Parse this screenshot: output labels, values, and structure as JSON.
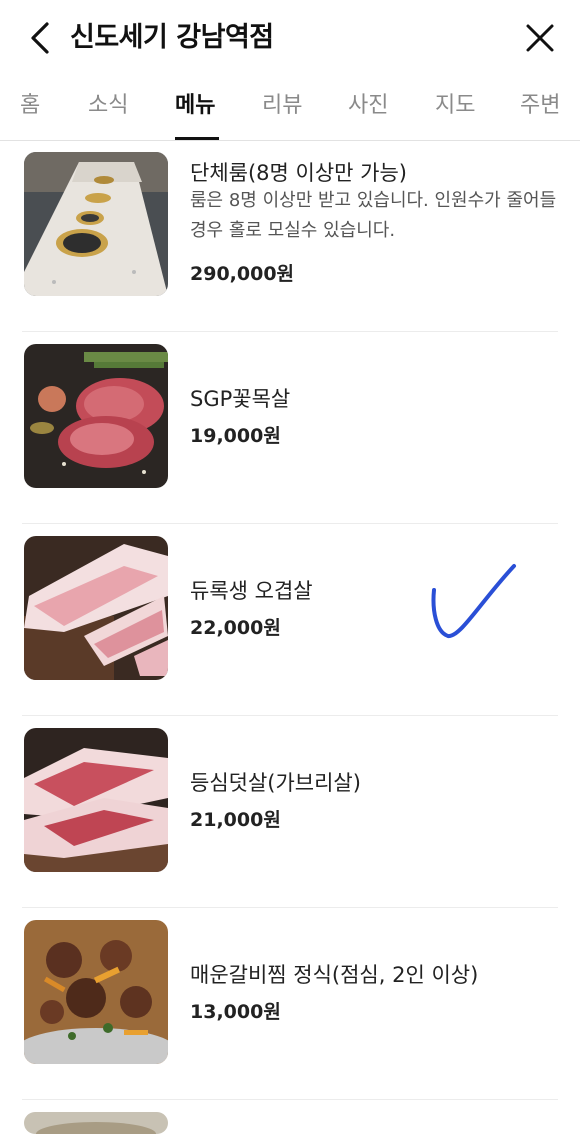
{
  "header": {
    "title": "신도세기 강남역점"
  },
  "tabs": [
    {
      "label": "홈",
      "active": false
    },
    {
      "label": "소식",
      "active": false
    },
    {
      "label": "메뉴",
      "active": true
    },
    {
      "label": "리뷰",
      "active": false
    },
    {
      "label": "사진",
      "active": false
    },
    {
      "label": "지도",
      "active": false
    },
    {
      "label": "주변",
      "active": false
    }
  ],
  "menu": {
    "items": [
      {
        "name": "단체룸(8명 이상만 가능)",
        "description": "룸은 8명 이상만 받고 있습니다. 인원수가 줄어들 경우 홀로 모실수 있습니다.",
        "price": "290,000원"
      },
      {
        "name": "SGP꽃목살",
        "price": "19,000원"
      },
      {
        "name": "듀록생 오겹살",
        "price": "22,000원"
      },
      {
        "name": "등심덧살(가브리살)",
        "price": "21,000원"
      },
      {
        "name": "매운갈비찜 정식(점심, 2인 이상)",
        "price": "13,000원"
      }
    ]
  },
  "colors": {
    "check_mark": "#2a4fd6",
    "tab_active": "#111111",
    "tab_inactive": "#8a8a8a"
  }
}
